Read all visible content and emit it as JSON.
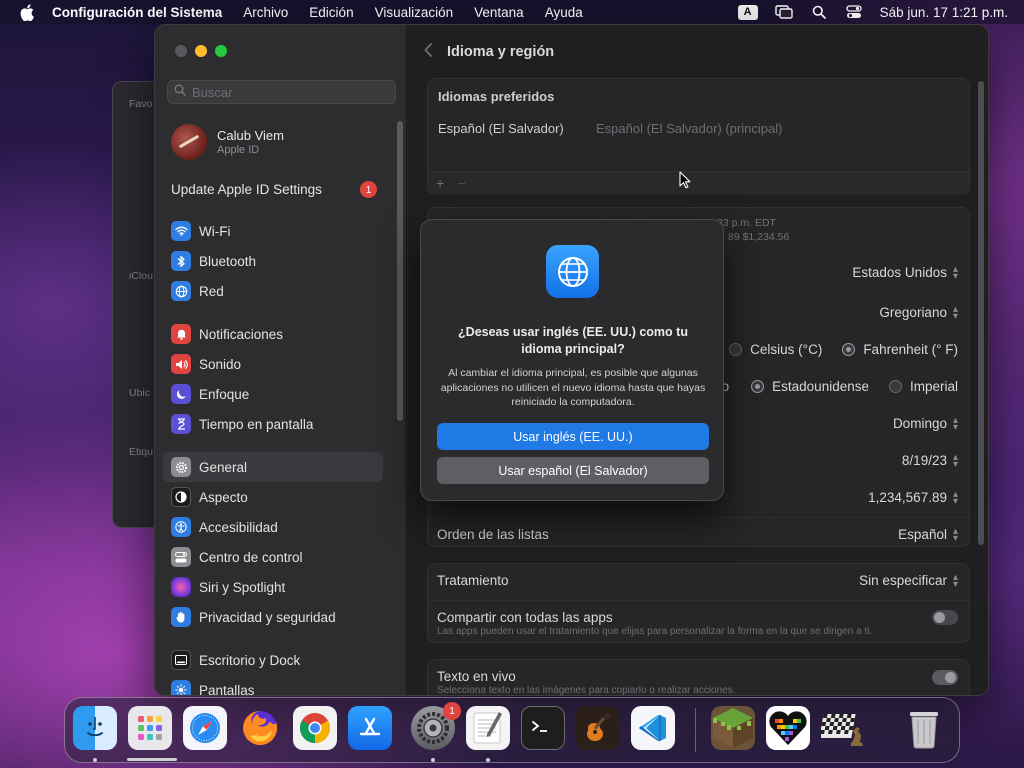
{
  "menubar": {
    "app_name": "Configuración del Sistema",
    "menus": [
      "Archivo",
      "Edición",
      "Visualización",
      "Ventana",
      "Ayuda"
    ],
    "input_indicator": "A",
    "clock": "Sáb jun. 17  1:21 p.m."
  },
  "back_window": {
    "labels": [
      "Favo",
      "iClou",
      "Ubic",
      "Etiqu"
    ]
  },
  "sidebar": {
    "search_placeholder": "Buscar",
    "profile": {
      "name": "Calub Viem",
      "subtitle": "Apple ID"
    },
    "update": {
      "label": "Update Apple ID Settings",
      "badge": "1"
    },
    "group1": [
      {
        "label": "Wi-Fi",
        "icon": "wifi-icon",
        "color": "#2f7de1"
      },
      {
        "label": "Bluetooth",
        "icon": "bluetooth-icon",
        "color": "#2f7de1"
      },
      {
        "label": "Red",
        "icon": "globe-icon",
        "color": "#2f7de1"
      }
    ],
    "group2": [
      {
        "label": "Notificaciones",
        "icon": "bell-icon",
        "color": "#e0443e"
      },
      {
        "label": "Sonido",
        "icon": "speaker-icon",
        "color": "#e0443e"
      },
      {
        "label": "Enfoque",
        "icon": "moon-icon",
        "color": "#5b4fd6"
      },
      {
        "label": "Tiempo en pantalla",
        "icon": "hourglass-icon",
        "color": "#5b4fd6"
      }
    ],
    "group3": [
      {
        "label": "General",
        "icon": "gear-icon",
        "color": "#8e8d92",
        "selected": true
      },
      {
        "label": "Aspecto",
        "icon": "appearance-icon",
        "color": "#1c1c1e"
      },
      {
        "label": "Accesibilidad",
        "icon": "accessibility-icon",
        "color": "#2f7de1"
      },
      {
        "label": "Centro de control",
        "icon": "control-center-icon",
        "color": "#8e8d92"
      },
      {
        "label": "Siri y Spotlight",
        "icon": "siri-icon",
        "color": "#b03ac2"
      },
      {
        "label": "Privacidad y seguridad",
        "icon": "hand-icon",
        "color": "#2f7de1"
      }
    ],
    "group4": [
      {
        "label": "Escritorio y Dock",
        "icon": "dock-icon",
        "color": "#1c1c1e"
      },
      {
        "label": "Pantallas",
        "icon": "sun-icon",
        "color": "#2f7de1"
      }
    ]
  },
  "content": {
    "title": "Idioma y región",
    "preferred": {
      "heading": "Idiomas preferidos",
      "language": "Español (El Salvador)",
      "language_detail": "Español (El Salvador) (principal)",
      "add": "+",
      "remove": "−"
    },
    "preview": {
      "line1": "Sab., 17 de jun. 2023, 1:20:33 p.m. EDT",
      "line2": "89    $1,234.56"
    },
    "rows": {
      "region_value": "Estados Unidos",
      "calendar_value": "Gregoriano",
      "temp_celsius": "Celsius (°C)",
      "temp_fahrenheit": "Fahrenheit (° F)",
      "measure_partial": "ico",
      "measure_us": "Estadounidense",
      "measure_imperial": "Imperial",
      "first_day_value": "Domingo",
      "date_format_value": "8/19/23",
      "number_format_value": "1,234,567.89",
      "list_order_label": "Orden de las listas",
      "list_order_value": "Español",
      "treatment_label": "Tratamiento",
      "treatment_value": "Sin especificar",
      "share_label": "Compartir con todas las apps",
      "share_hint": "Las apps pueden usar el tratamiento que elijas para personalizar la forma en la que se dirigen a ti.",
      "live_text_label": "Texto en vivo",
      "live_text_hint": "Selecciona texto en las imágenes para copiarlo o realizar acciones."
    }
  },
  "dialog": {
    "question": "¿Deseas usar inglés (EE. UU.) como tu idioma principal?",
    "message": "Al cambiar el idioma principal, es posible que algunas aplicaciones no utilicen el nuevo idioma hasta que hayas reiniciado la computadora.",
    "primary_button": "Usar inglés (EE. UU.)",
    "secondary_button": "Usar español (El Salvador)"
  },
  "dock": {
    "apps": [
      {
        "name": "finder-icon",
        "color": "#3a8ff0"
      },
      {
        "name": "launchpad-icon",
        "color": "#e9e9ee"
      },
      {
        "name": "safari-icon",
        "color": "#f4f6fa"
      },
      {
        "name": "firefox-icon",
        "color": "#6b3fd9"
      },
      {
        "name": "chrome-icon",
        "color": "#f2f2f2"
      },
      {
        "name": "app-store-icon",
        "color": "#1d8cf5"
      },
      {
        "name": "system-settings-icon",
        "color": "#7c7b80"
      },
      {
        "name": "textedit-icon",
        "color": "#f4f4f4"
      },
      {
        "name": "terminal-icon",
        "color": "#1e1e1e"
      },
      {
        "name": "garageband-icon",
        "color": "#3b2a22"
      },
      {
        "name": "vscode-icon",
        "color": "#f4f6fa"
      },
      {
        "name": "minecraft-icon",
        "color": "#6b8e3a"
      },
      {
        "name": "pixel-heart-icon",
        "color": "#ffffff"
      },
      {
        "name": "chess-icon",
        "color": "#d9d9d9"
      },
      {
        "name": "trash-icon",
        "color": "#b9b9be"
      }
    ],
    "settings_badge": "1"
  }
}
